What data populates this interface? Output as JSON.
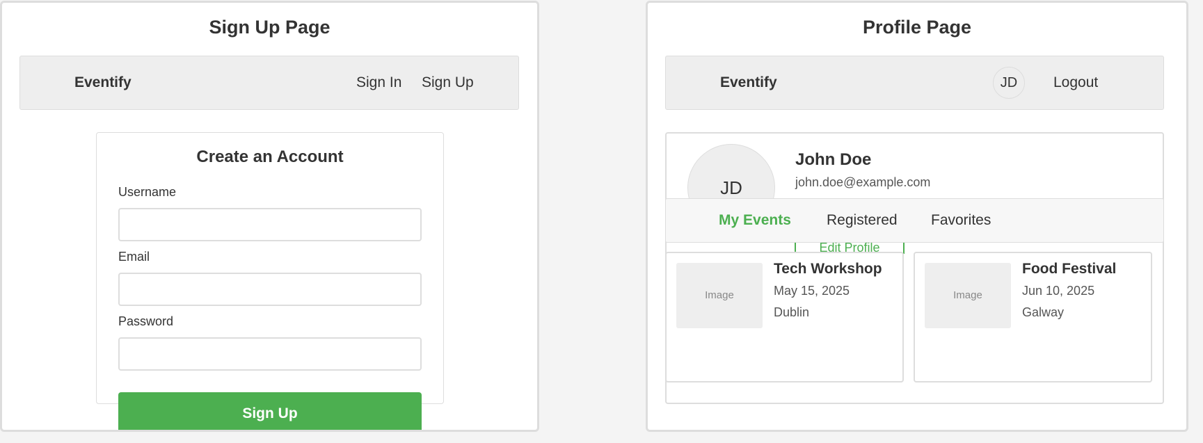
{
  "signup_page": {
    "title": "Sign Up Page",
    "navbar": {
      "brand": "Eventify",
      "sign_in": "Sign In",
      "sign_up": "Sign Up"
    },
    "form": {
      "heading": "Create an Account",
      "username_label": "Username",
      "username_value": "",
      "email_label": "Email",
      "email_value": "",
      "password_label": "Password",
      "password_value": "",
      "submit_label": "Sign Up"
    }
  },
  "profile_page": {
    "title": "Profile Page",
    "navbar": {
      "brand": "Eventify",
      "avatar_initials": "JD",
      "logout": "Logout"
    },
    "profile": {
      "avatar_initials": "JD",
      "name": "John Doe",
      "email": "john.doe@example.com",
      "edit_label": "Edit Profile"
    },
    "tabs": [
      {
        "label": "My Events",
        "active": true
      },
      {
        "label": "Registered",
        "active": false
      },
      {
        "label": "Favorites",
        "active": false
      }
    ],
    "events": [
      {
        "image_label": "Image",
        "title": "Tech Workshop",
        "date": "May 15, 2025",
        "location": "Dublin"
      },
      {
        "image_label": "Image",
        "title": "Food Festival",
        "date": "Jun 10, 2025",
        "location": "Galway"
      }
    ]
  },
  "colors": {
    "accent": "#4caf50",
    "navbar_bg": "#eeeeee",
    "border": "#dddddd",
    "page_bg": "#f4f4f4"
  }
}
